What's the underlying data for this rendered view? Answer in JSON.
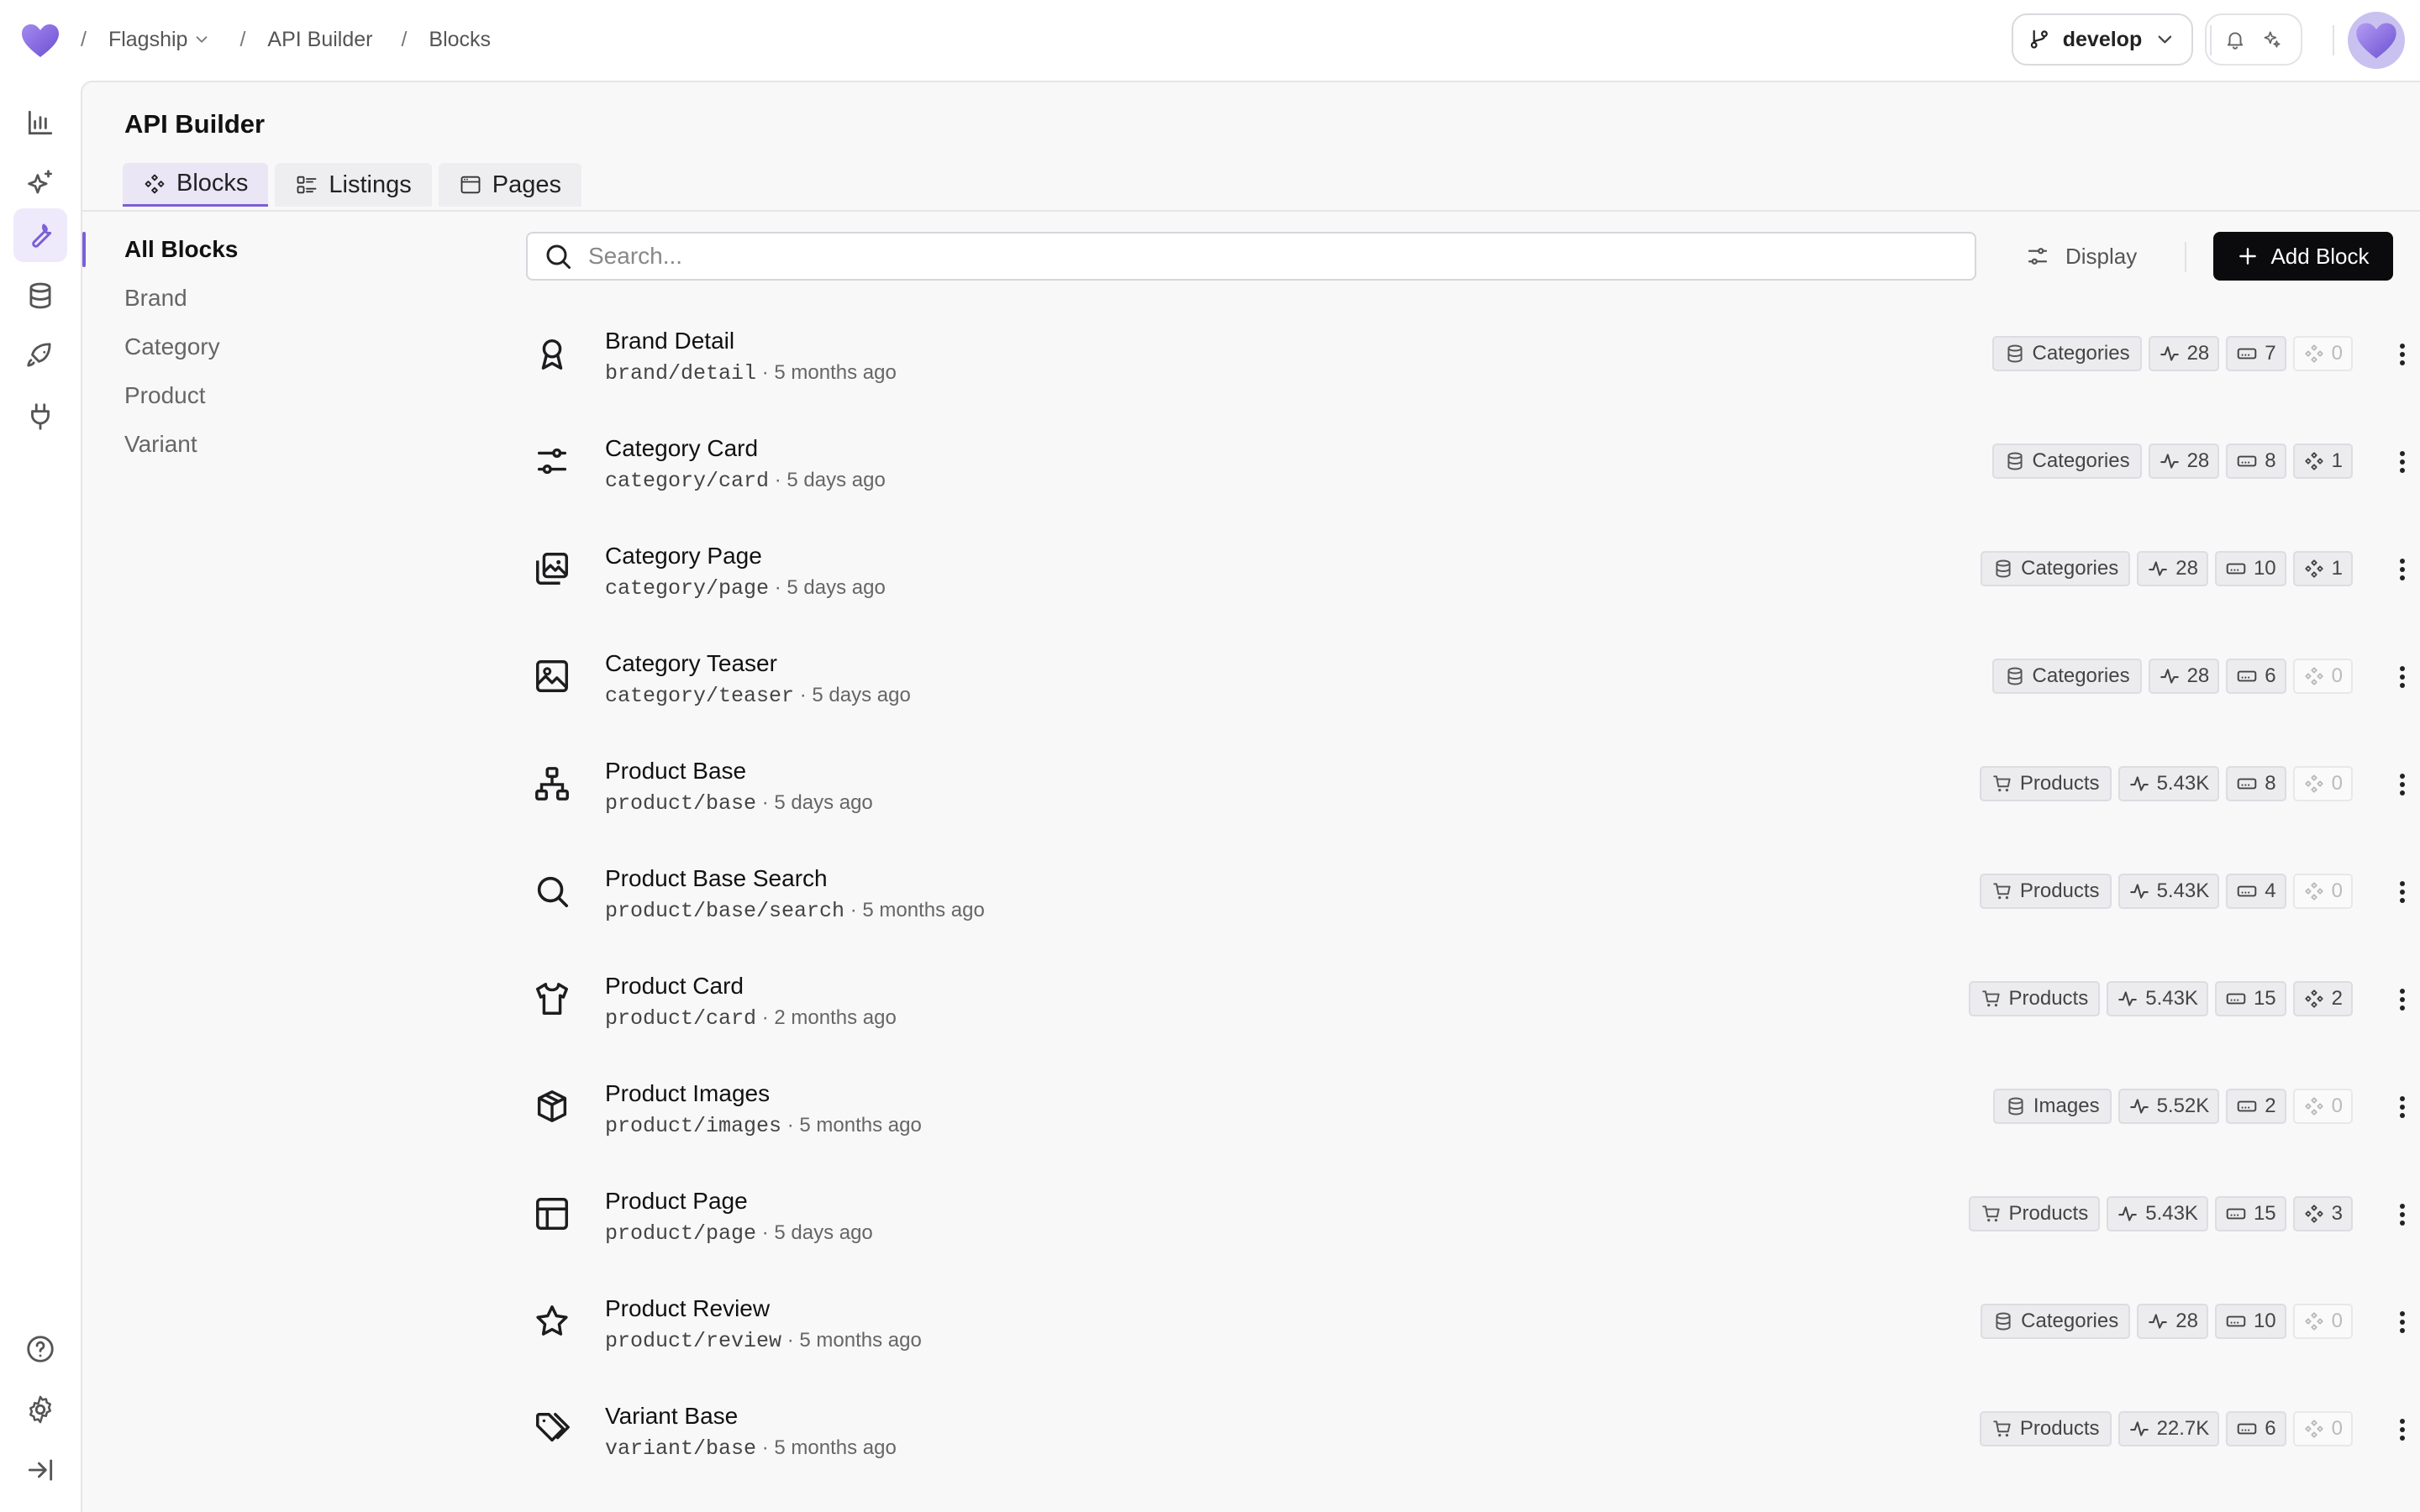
{
  "breadcrumbs": [
    {
      "label": "Flagship",
      "dropdown": true
    },
    {
      "label": "API Builder",
      "dropdown": false
    },
    {
      "label": "Blocks",
      "dropdown": false
    }
  ],
  "branch": {
    "label": "develop"
  },
  "colors": {
    "accent": "#7c5fd6",
    "primary_button": "#0b0b0d"
  },
  "page": {
    "title": "API Builder"
  },
  "tabs": [
    {
      "label": "Blocks",
      "icon": "component-icon",
      "active": true
    },
    {
      "label": "Listings",
      "icon": "list-icon",
      "active": false
    },
    {
      "label": "Pages",
      "icon": "browser-window-icon",
      "active": false
    }
  ],
  "filters": [
    {
      "label": "All Blocks",
      "active": true
    },
    {
      "label": "Brand",
      "active": false
    },
    {
      "label": "Category",
      "active": false
    },
    {
      "label": "Product",
      "active": false
    },
    {
      "label": "Variant",
      "active": false
    }
  ],
  "search": {
    "placeholder": "Search..."
  },
  "toolbar": {
    "display_label": "Display",
    "add_label": "Add Block"
  },
  "blocks": [
    {
      "name": "Brand Detail",
      "path": "brand/detail",
      "time": "5 months ago",
      "icon": "award-icon",
      "source": "Categories",
      "source_icon": "database-icon",
      "requests": "28",
      "fields": "7",
      "components": "0"
    },
    {
      "name": "Category Card",
      "path": "category/card",
      "time": "5 days ago",
      "icon": "sliders-icon",
      "source": "Categories",
      "source_icon": "database-icon",
      "requests": "28",
      "fields": "8",
      "components": "1"
    },
    {
      "name": "Category Page",
      "path": "category/page",
      "time": "5 days ago",
      "icon": "images-icon",
      "source": "Categories",
      "source_icon": "database-icon",
      "requests": "28",
      "fields": "10",
      "components": "1"
    },
    {
      "name": "Category Teaser",
      "path": "category/teaser",
      "time": "5 days ago",
      "icon": "image-icon",
      "source": "Categories",
      "source_icon": "database-icon",
      "requests": "28",
      "fields": "6",
      "components": "0"
    },
    {
      "name": "Product Base",
      "path": "product/base",
      "time": "5 days ago",
      "icon": "hierarchy-icon",
      "source": "Products",
      "source_icon": "cart-icon",
      "requests": "5.43K",
      "fields": "8",
      "components": "0"
    },
    {
      "name": "Product Base Search",
      "path": "product/base/search",
      "time": "5 months ago",
      "icon": "search-icon",
      "source": "Products",
      "source_icon": "cart-icon",
      "requests": "5.43K",
      "fields": "4",
      "components": "0"
    },
    {
      "name": "Product Card",
      "path": "product/card",
      "time": "2 months ago",
      "icon": "shirt-icon",
      "source": "Products",
      "source_icon": "cart-icon",
      "requests": "5.43K",
      "fields": "15",
      "components": "2"
    },
    {
      "name": "Product Images",
      "path": "product/images",
      "time": "5 months ago",
      "icon": "box-icon",
      "source": "Images",
      "source_icon": "database-icon",
      "requests": "5.52K",
      "fields": "2",
      "components": "0"
    },
    {
      "name": "Product Page",
      "path": "product/page",
      "time": "5 days ago",
      "icon": "layout-icon",
      "source": "Products",
      "source_icon": "cart-icon",
      "requests": "5.43K",
      "fields": "15",
      "components": "3"
    },
    {
      "name": "Product Review",
      "path": "product/review",
      "time": "5 months ago",
      "icon": "star-icon",
      "source": "Categories",
      "source_icon": "database-icon",
      "requests": "28",
      "fields": "10",
      "components": "0"
    },
    {
      "name": "Variant Base",
      "path": "variant/base",
      "time": "5 months ago",
      "icon": "tag-icon",
      "source": "Products",
      "source_icon": "cart-icon",
      "requests": "22.7K",
      "fields": "6",
      "components": "0"
    }
  ]
}
